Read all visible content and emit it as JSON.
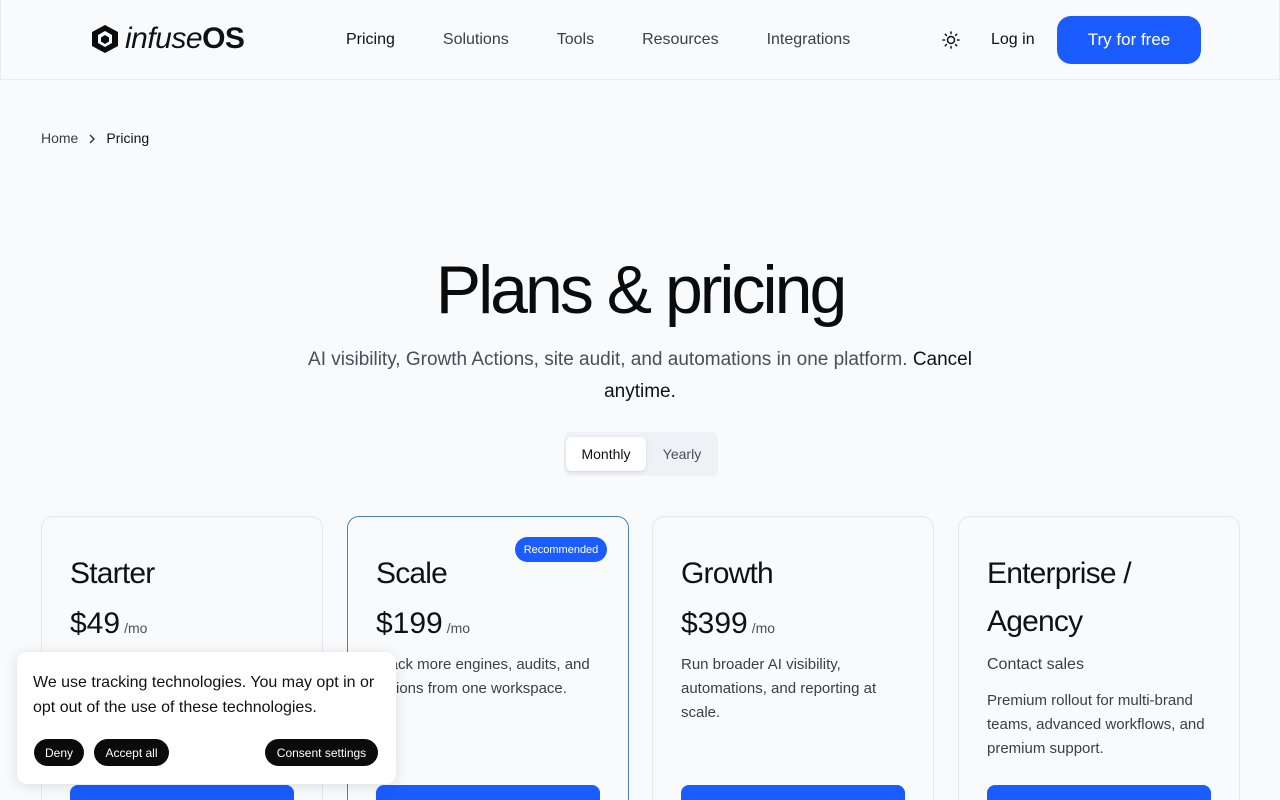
{
  "brand": {
    "logo_part1": "infuse",
    "logo_part2": "OS",
    "accent_color": "#1a5cff"
  },
  "nav": {
    "items": [
      {
        "label": "Pricing",
        "active": true
      },
      {
        "label": "Solutions"
      },
      {
        "label": "Tools"
      },
      {
        "label": "Resources"
      },
      {
        "label": "Integrations"
      }
    ],
    "theme_icon": "sun-icon",
    "login_label": "Log in",
    "cta_label": "Try for free"
  },
  "breadcrumb": {
    "home": "Home",
    "current": "Pricing"
  },
  "hero": {
    "title": "Plans & pricing",
    "subtitle": "AI visibility, Growth Actions, site audit, and automations in one platform.",
    "subtitle_strong": "Cancel anytime."
  },
  "billing_toggle": {
    "monthly": "Monthly",
    "yearly": "Yearly",
    "selected": "Monthly"
  },
  "plans": [
    {
      "name": "Starter",
      "price": "$49",
      "period": "/mo",
      "description": ""
    },
    {
      "name": "Scale",
      "price": "$199",
      "period": "/mo",
      "badge": "Recommended",
      "description": "Track more engines, audits, and actions from one workspace."
    },
    {
      "name": "Growth",
      "price": "$399",
      "period": "/mo",
      "description": "Run broader AI visibility, automations, and reporting at scale."
    },
    {
      "name": "Enterprise / Agency",
      "contact": "Contact sales",
      "description": "Premium rollout for multi-brand teams, advanced workflows, and premium support."
    }
  ],
  "cookie_banner": {
    "message": "We use tracking technologies. You may opt in or opt out of the use of these technologies.",
    "deny": "Deny",
    "accept": "Accept all",
    "settings": "Consent settings"
  }
}
